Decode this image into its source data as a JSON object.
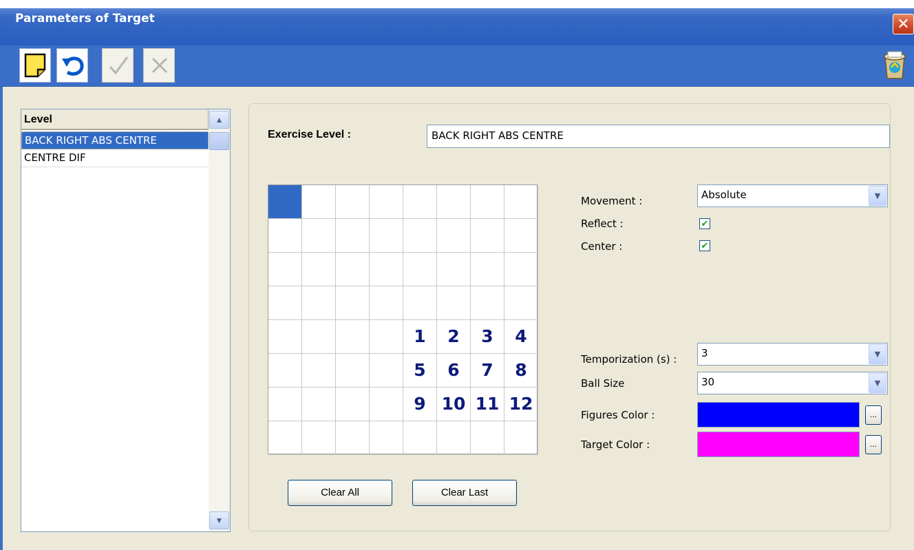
{
  "window": {
    "title": "Parameters of Target",
    "close_glyph": "✕"
  },
  "toolbar": {
    "buttons": [
      {
        "name": "new-note",
        "icon": "new-note-icon",
        "enabled": true
      },
      {
        "name": "undo",
        "icon": "undo-icon",
        "enabled": true
      },
      {
        "name": "confirm",
        "icon": "check-icon",
        "enabled": false
      },
      {
        "name": "cancel",
        "icon": "x-icon",
        "enabled": false
      },
      {
        "name": "recycle",
        "icon": "recycle-bin-icon",
        "enabled": true
      }
    ]
  },
  "level_list": {
    "header": "Level",
    "items": [
      "BACK RIGHT ABS CENTRE",
      "CENTRE DIF"
    ],
    "selected_index": 0,
    "scroll_up": "▲",
    "scroll_down": "▼"
  },
  "exercise": {
    "label": "Exercise Level :",
    "value": "BACK RIGHT ABS CENTRE"
  },
  "grid": {
    "rows": 8,
    "cols": 8,
    "filled_cells": [
      [
        0,
        0
      ]
    ],
    "numbers": [
      {
        "row": 4,
        "col": 4,
        "text": "1"
      },
      {
        "row": 4,
        "col": 5,
        "text": "2"
      },
      {
        "row": 4,
        "col": 6,
        "text": "3"
      },
      {
        "row": 4,
        "col": 7,
        "text": "4"
      },
      {
        "row": 5,
        "col": 4,
        "text": "5"
      },
      {
        "row": 5,
        "col": 5,
        "text": "6"
      },
      {
        "row": 5,
        "col": 6,
        "text": "7"
      },
      {
        "row": 5,
        "col": 7,
        "text": "8"
      },
      {
        "row": 6,
        "col": 4,
        "text": "9"
      },
      {
        "row": 6,
        "col": 5,
        "text": "10"
      },
      {
        "row": 6,
        "col": 6,
        "text": "11"
      },
      {
        "row": 6,
        "col": 7,
        "text": "12"
      }
    ],
    "fill_color": "#316ac5",
    "number_color": "#0c1a7a"
  },
  "buttons": {
    "clear_all": "Clear All",
    "clear_last": "Clear Last"
  },
  "settings": {
    "movement": {
      "label": "Movement :",
      "value": "Absolute"
    },
    "reflect": {
      "label": "Reflect :",
      "checked": true
    },
    "center": {
      "label": "Center :",
      "checked": true
    },
    "temporization": {
      "label": "Temporization (s) :",
      "value": "3"
    },
    "ball_size": {
      "label": "Ball Size",
      "value": "30"
    },
    "figures_color": {
      "label": "Figures Color :",
      "color": "#0000ff"
    },
    "target_color": {
      "label": "Target Color :",
      "color": "#ff00ff"
    },
    "dropdown_glyph": "▼",
    "check_glyph": "✔",
    "ellipsis": "..."
  }
}
